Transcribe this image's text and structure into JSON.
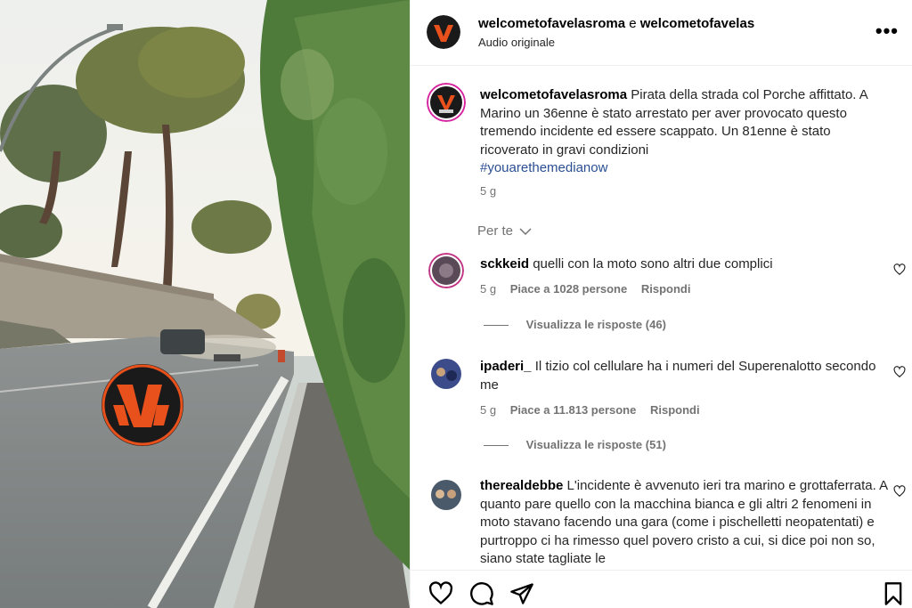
{
  "post": {
    "header": {
      "account_primary": "welcometofavelasroma",
      "joiner": "e",
      "account_secondary": "welcometofavelas",
      "audio": "Audio originale"
    },
    "caption": {
      "username": "welcometofavelasroma",
      "text": "Pirata della strada col Porche affittato. A Marino un 36enne è stato arrestato per aver provocato questo tremendo incidente ed essere scappato. Un 81enne è stato ricoverato in gravi condizioni",
      "hashtag": "#youarethemedianow",
      "time": "5 g"
    },
    "filter_label": "Per te",
    "comments": [
      {
        "username": "sckkeid",
        "text": "quelli con la moto sono altri due complici",
        "time": "5 g",
        "likes": "Piace a 1028 persone",
        "reply": "Rispondi",
        "view_replies": "Visualizza le risposte (46)"
      },
      {
        "username": "ipaderi_",
        "text": "Il tizio col cellulare ha i numeri del Superenalotto secondo me",
        "time": "5 g",
        "likes": "Piace a 11.813 persone",
        "reply": "Rispondi",
        "view_replies": "Visualizza le risposte (51)"
      },
      {
        "username": "therealdebbe",
        "text": "L'incidente è avvenuto ieri tra marino e grottaferrata. A quanto pare quello con la macchina bianca e gli altri 2 fenomeni in moto stavano facendo una gara (come i pischelletti neopatentati) e purtroppo ci ha rimesso quel povero cristo a cui, si dice poi non so, siano state tagliate le"
      }
    ]
  },
  "icons": {
    "more": "more-options-icon",
    "heart": "heart-icon",
    "comment": "comment-icon",
    "share": "share-icon",
    "save": "bookmark-icon"
  },
  "colors": {
    "brand_orange": "#e8501c",
    "hashtag": "#2a4f93",
    "muted": "#737373"
  }
}
